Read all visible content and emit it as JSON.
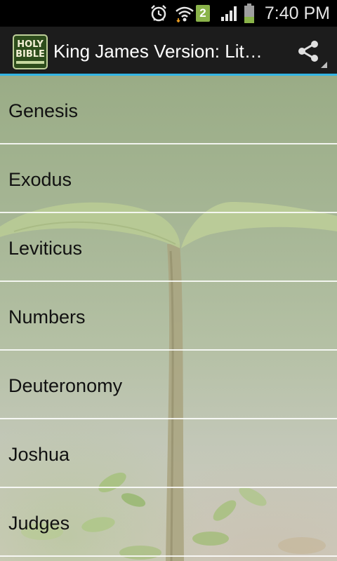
{
  "status_bar": {
    "time": "7:40 PM",
    "notification_count": "2",
    "icons": [
      "alarm-icon",
      "wifi-icon",
      "notification-badge",
      "signal-icon",
      "battery-icon"
    ]
  },
  "action_bar": {
    "logo_line1": "HOLY",
    "logo_line2": "BIBLE",
    "title": "King James Version: Lit…",
    "share_icon": "share-icon",
    "accent_color": "#33b5e5"
  },
  "books": [
    {
      "label": "Genesis"
    },
    {
      "label": "Exodus"
    },
    {
      "label": "Leviticus"
    },
    {
      "label": "Numbers"
    },
    {
      "label": "Deuteronomy"
    },
    {
      "label": "Joshua"
    },
    {
      "label": "Judges"
    }
  ]
}
